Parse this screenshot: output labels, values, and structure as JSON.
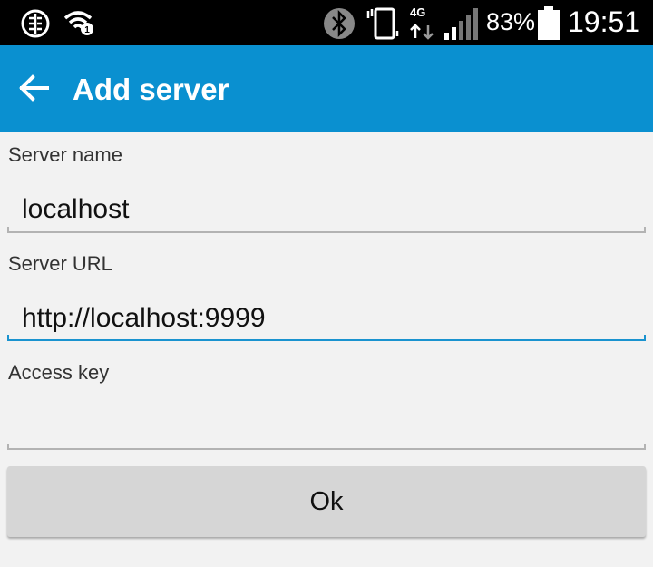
{
  "status_bar": {
    "network_label": "4G",
    "battery_percent": "83%",
    "time": "19:51",
    "icons": [
      "brain-icon",
      "wifi-icon",
      "bluetooth-icon",
      "vibrate-icon",
      "network-4g-icon",
      "signal-icon",
      "battery-icon"
    ]
  },
  "app_bar": {
    "title": "Add server",
    "back_icon": "arrow-back-icon",
    "color": "#0a90d0"
  },
  "form": {
    "server_name": {
      "label": "Server name",
      "value": "localhost",
      "placeholder": ""
    },
    "server_url": {
      "label": "Server URL",
      "value": "http://localhost:9999",
      "placeholder": ""
    },
    "access_key": {
      "label": "Access key",
      "value": "",
      "placeholder": ""
    },
    "focus_color": "#1a93cf",
    "ok_label": "Ok"
  }
}
